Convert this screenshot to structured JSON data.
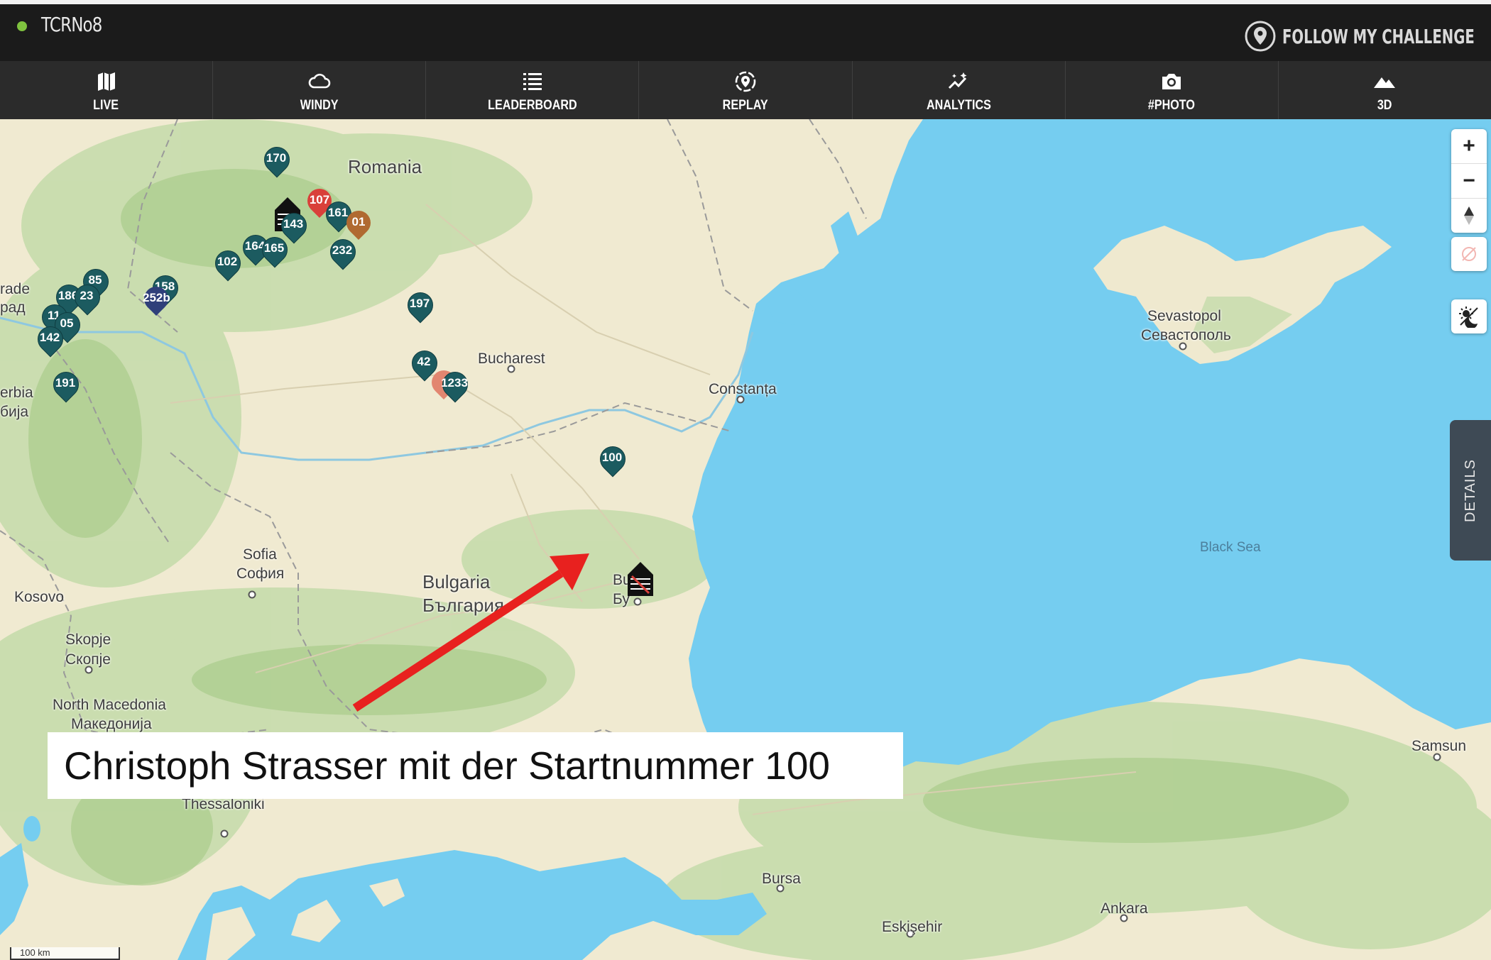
{
  "header": {
    "event_name": "TCRNo8",
    "brand": "FOLLOW MY CHALLENGE",
    "status_color": "#7fc23f"
  },
  "nav": {
    "items": [
      {
        "label": "LIVE",
        "icon": "map-icon"
      },
      {
        "label": "WINDY",
        "icon": "cloud-icon"
      },
      {
        "label": "LEADERBOARD",
        "icon": "list-icon"
      },
      {
        "label": "REPLAY",
        "icon": "replay-pin-icon"
      },
      {
        "label": "ANALYTICS",
        "icon": "analytics-icon"
      },
      {
        "label": "#PHOTO",
        "icon": "camera-icon"
      },
      {
        "label": "3D",
        "icon": "mountain-icon"
      }
    ]
  },
  "map": {
    "places": {
      "romania": "Romania",
      "bucharest": "Bucharest",
      "constanta": "Constanța",
      "sevastopol": "Sevastopol",
      "sevastopol_cyr": "Севастополь",
      "black_sea": "Black Sea",
      "sofia": "Sofia",
      "sofia_cyr": "София",
      "bulgaria": "Bulgaria",
      "bulgaria_cyr": "България",
      "burgas": "Bu",
      "burgas_cyr": "Бу",
      "kosovo": "Kosovo",
      "skopje": "Skopje",
      "skopje_cyr": "Скопје",
      "north_macedonia": "North Macedonia",
      "north_macedonia_cyr": "Македонија",
      "thessaloniki": "Thessaloniki",
      "bursa": "Bursa",
      "ankara": "Ankara",
      "eskisehir": "Eskişehir",
      "samsun": "Samsun",
      "belgrade_partial": "rade",
      "belgrade_cyr_partial": "рад",
      "serbia_partial": "erbia",
      "serbia_cyr_partial": "бија"
    },
    "pins": [
      {
        "num": "170",
        "style": "teal"
      },
      {
        "num": "107",
        "style": "red"
      },
      {
        "num": "161",
        "style": "teal"
      },
      {
        "num": "01",
        "style": "orange"
      },
      {
        "num": "143",
        "style": "teal"
      },
      {
        "num": "164",
        "style": "teal"
      },
      {
        "num": "165",
        "style": "teal"
      },
      {
        "num": "232",
        "style": "teal"
      },
      {
        "num": "102",
        "style": "teal"
      },
      {
        "num": "85",
        "style": "teal"
      },
      {
        "num": "186",
        "style": "teal"
      },
      {
        "num": "23",
        "style": "teal"
      },
      {
        "num": "158",
        "style": "teal"
      },
      {
        "num": "252b",
        "style": "navy"
      },
      {
        "num": "11",
        "style": "teal"
      },
      {
        "num": "05",
        "style": "teal"
      },
      {
        "num": "142",
        "style": "teal"
      },
      {
        "num": "191",
        "style": "teal"
      },
      {
        "num": "197",
        "style": "teal"
      },
      {
        "num": "42",
        "style": "teal"
      },
      {
        "num": "1233",
        "style": "teal"
      },
      {
        "num": "100",
        "style": "teal"
      }
    ],
    "scale_label": "100 km"
  },
  "controls": {
    "zoom_in": "+",
    "zoom_out": "−",
    "details": "DETAILS"
  },
  "annotation": {
    "caption": "Christoph Strasser mit der Startnummer 100",
    "arrow_color": "#e8211f"
  }
}
